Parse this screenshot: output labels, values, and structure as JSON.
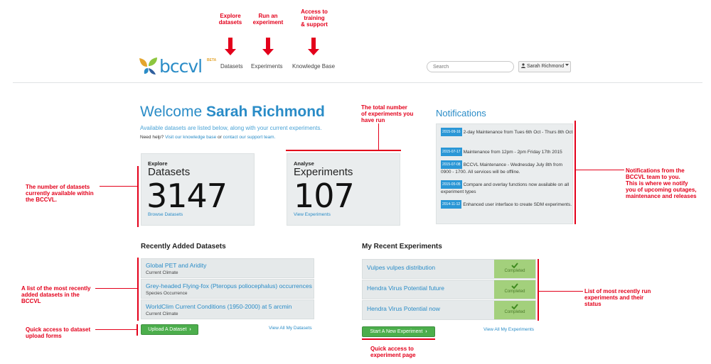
{
  "annotations": {
    "explore": [
      "Explore",
      "datasets"
    ],
    "run": [
      "Run an",
      "experiment"
    ],
    "access": [
      "Access to",
      "training",
      "& support"
    ],
    "total": [
      "The total number",
      "of experiments you",
      "have run"
    ],
    "num_datasets": [
      "The number of datasets",
      "currently available within",
      "the BCCVL."
    ],
    "notifications": [
      "Notifications from the",
      "BCCVL team to you.",
      "This is where we notify",
      "you of upcoming outages,",
      "maintenance and releases"
    ],
    "recent_datasets": [
      "A list of the most recently",
      "added datasets in the",
      "BCCVL"
    ],
    "recent_experiments": [
      "List of most recently run",
      "experiments and their",
      "status"
    ],
    "upload_access": [
      "Quick access to dataset",
      "upload forms"
    ],
    "experiment_access": [
      "Quick access to",
      "experiment page"
    ]
  },
  "header": {
    "logo_text": "bccvl",
    "beta": "BETA",
    "nav": [
      "Datasets",
      "Experiments",
      "Knowledge Base"
    ],
    "search_placeholder": "Search",
    "user": "Sarah Richmond"
  },
  "welcome": {
    "prefix": "Welcome",
    "name": "Sarah Richmond",
    "subtitle": "Available datasets are listed below, along with your current experiments.",
    "help_prefix": "Need help?",
    "help_kb": "Visit our knowledge base",
    "help_or": "or",
    "help_contact": "contact our support team."
  },
  "explore_panel": {
    "kicker": "Explore",
    "title": "Datasets",
    "count": "3147",
    "link": "Browse Datasets"
  },
  "analyse_panel": {
    "kicker": "Analyse",
    "title": "Experiments",
    "count": "107",
    "link": "View Experiments"
  },
  "notifications": {
    "title": "Notifications",
    "items": [
      {
        "date": "2015-09-16",
        "text": "2-day Maintenance from Tues 6th Oct - Thurs 8th Oct"
      },
      {
        "date": "2015-07-17",
        "text": "Maintenance from 12pm - 2pm Friday 17th 2015"
      },
      {
        "date": "2015-07-08",
        "text": "BCCVL Maintenance - Wednesday July 8th from 0900 - 1700. All services will be offline."
      },
      {
        "date": "2015-05-05",
        "text": "Compare and overlay functions now available on all experiment types"
      },
      {
        "date": "2014-11-12",
        "text": "Enhanced user interface to create SDM experiments."
      }
    ]
  },
  "recent_datasets": {
    "title": "Recently Added Datasets",
    "items": [
      {
        "title": "Global PET and Aridity",
        "type": "Current Climate"
      },
      {
        "title": "Grey-headed Flying-fox (Pteropus poliocephalus) occurrences",
        "type": "Species Occurrence"
      },
      {
        "title": "WorldClim Current Conditions (1950-2000) at 5 arcmin",
        "type": "Current Climate"
      }
    ],
    "button": "Upload A Dataset",
    "view_all": "View All My Datasets"
  },
  "recent_experiments": {
    "title": "My Recent Experiments",
    "items": [
      {
        "title": "Vulpes vulpes distribution",
        "status": "Completed"
      },
      {
        "title": "Hendra Virus Potential future",
        "status": "Completed"
      },
      {
        "title": "Hendra Virus Potential now",
        "status": "Completed"
      }
    ],
    "button": "Start A New Experiment",
    "view_all": "View All My Experiments"
  },
  "colors": {
    "accent": "#2a8cc7",
    "annotation": "#e3001b",
    "success": "#4cae4c",
    "completed": "#a3d07c"
  }
}
